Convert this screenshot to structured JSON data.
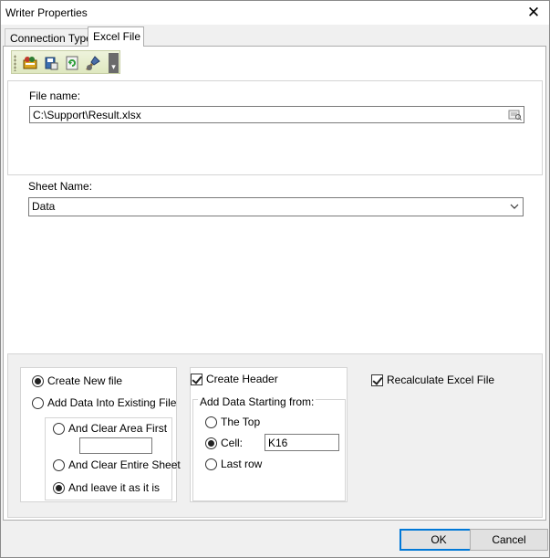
{
  "window": {
    "title": "Writer Properties",
    "close_glyph": "✕"
  },
  "tabs": [
    {
      "label": "Connection Type"
    },
    {
      "label": "Excel File"
    }
  ],
  "toolbar": {
    "icons": [
      "properties-icon",
      "save-icon",
      "refresh-icon",
      "brush-icon"
    ],
    "more_glyph": "▾"
  },
  "file": {
    "label": "File name:",
    "value": "C:\\Support\\Result.xlsx"
  },
  "sheet": {
    "label": "Sheet Name:",
    "value": "Data"
  },
  "mode": {
    "create_new": "Create New file",
    "add_existing": "Add Data Into Existing File",
    "clear_area": "And Clear Area First",
    "clear_area_value": "",
    "clear_sheet": "And Clear Entire Sheet",
    "leave_as_is": "And leave it as it is",
    "selected_mode": "create_new",
    "selected_sub": "leave_as_is"
  },
  "header": {
    "create_header": "Create Header",
    "create_header_checked": true,
    "group_label": "Add Data Starting from:",
    "the_top": "The Top",
    "cell": "Cell:",
    "cell_value": "K16",
    "last_row": "Last row",
    "selected_start": "cell"
  },
  "recalc": {
    "label": "Recalculate Excel File",
    "checked": true
  },
  "buttons": {
    "ok": "OK",
    "cancel": "Cancel"
  }
}
